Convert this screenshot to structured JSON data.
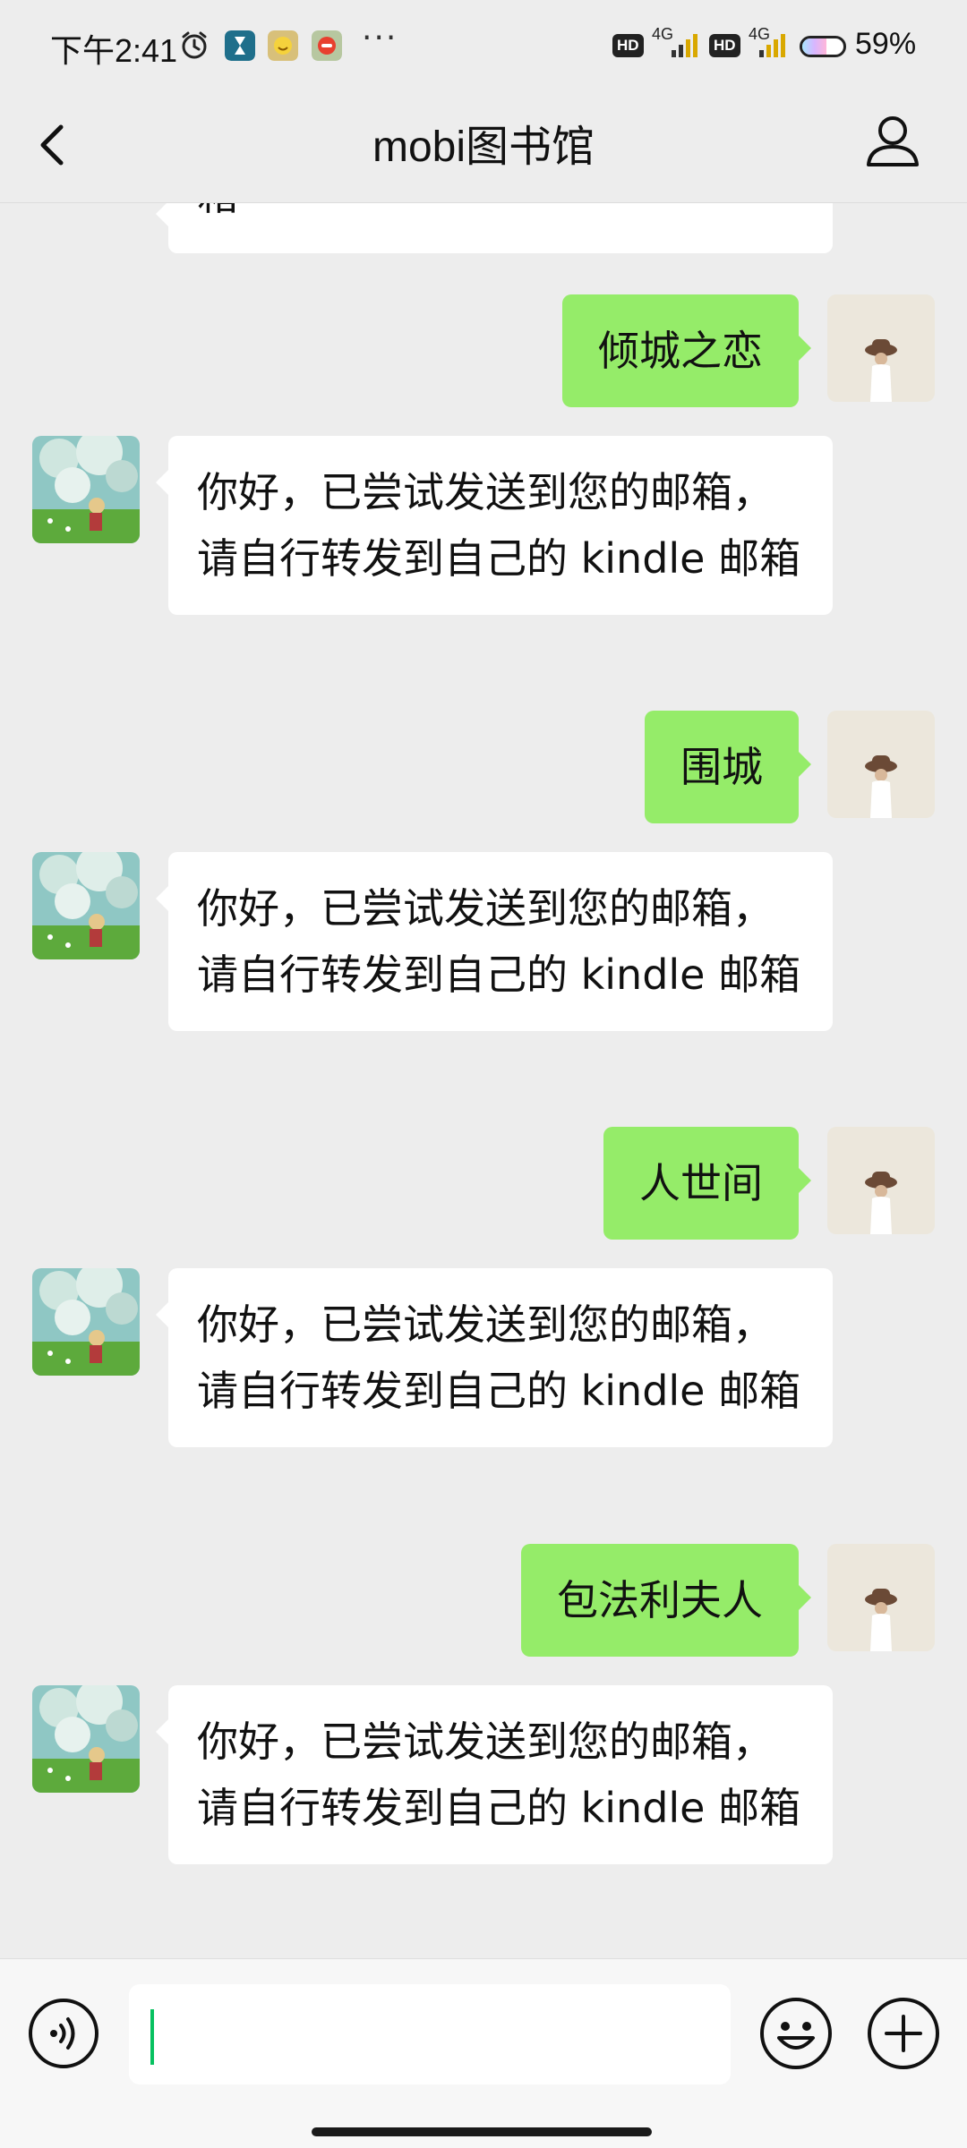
{
  "status_bar": {
    "time": "下午2:41",
    "network_1": "4G",
    "network_2": "4G",
    "hd_1": "HD",
    "hd_2": "HD",
    "battery_percent": "59%",
    "battery_level": 0.59,
    "more_dots": "···",
    "icons": [
      "alarm-icon",
      "hourglass-app-icon",
      "emoji-app-icon",
      "red-app-icon"
    ]
  },
  "header": {
    "title": "mobi图书馆",
    "back_icon": "chevron-left-icon",
    "profile_icon": "person-icon"
  },
  "messages": [
    {
      "from": "other",
      "text": "箱",
      "partial": true
    },
    {
      "from": "me",
      "text": "倾城之恋"
    },
    {
      "from": "other",
      "text": "你好，已尝试发送到您的邮箱，请自行转发到自己的 kindle 邮箱"
    },
    {
      "from": "me",
      "text": "围城"
    },
    {
      "from": "other",
      "text": "你好，已尝试发送到您的邮箱，请自行转发到自己的 kindle 邮箱"
    },
    {
      "from": "me",
      "text": "人世间"
    },
    {
      "from": "other",
      "text": "你好，已尝试发送到您的邮箱，请自行转发到自己的 kindle 邮箱"
    },
    {
      "from": "me",
      "text": "包法利夫人"
    },
    {
      "from": "other",
      "text": "你好，已尝试发送到您的邮箱，请自行转发到自己的 kindle 邮箱"
    }
  ],
  "input_bar": {
    "value": "",
    "voice_icon": "voice-icon",
    "emoji_icon": "emoji-icon",
    "plus_icon": "plus-circle-icon"
  },
  "colors": {
    "background": "#ededed",
    "outgoing_bubble": "#95ec69",
    "incoming_bubble": "#ffffff",
    "cursor": "#07c160"
  }
}
